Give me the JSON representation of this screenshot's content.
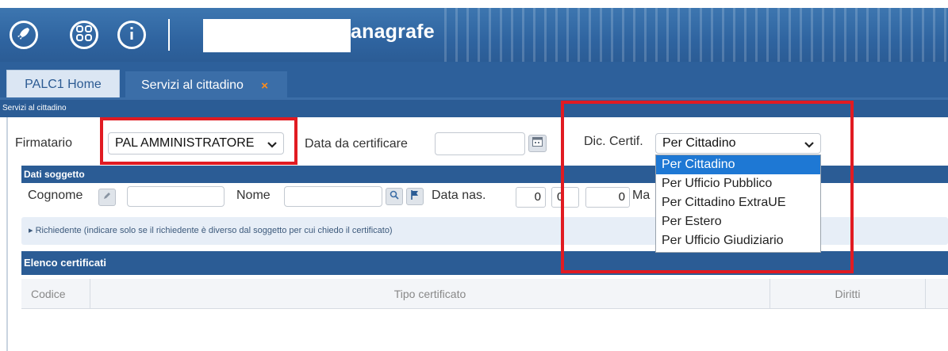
{
  "header": {
    "title": "anagrafe",
    "buttons": [
      {
        "name": "rocket-icon"
      },
      {
        "name": "apps-grid-icon"
      },
      {
        "name": "info-icon"
      }
    ],
    "brand_color": "#2f64a0"
  },
  "tabs": [
    {
      "label": "PALC1 Home",
      "active": false
    },
    {
      "label": "Servizi al cittadino",
      "active": true,
      "close_icon": "×"
    }
  ],
  "breadcrumb": "Servizi al cittadino",
  "form": {
    "firmatario_label": "Firmatario",
    "firmatario_value": "PAL AMMINISTRATORE",
    "data_label": "Data da certificare",
    "data_value": "",
    "dic_label": "Dic. Certif.",
    "dic_value": "Per Cittadino",
    "dic_options": [
      "Per Cittadino",
      "Per Ufficio Pubblico",
      "Per Cittadino ExtraUE",
      "Per Estero",
      "Per Ufficio Giudiziario"
    ]
  },
  "dati_soggetto": {
    "header": "Dati soggetto",
    "cognome_label": "Cognome",
    "cognome_value": "",
    "nome_label": "Nome",
    "nome_value": "",
    "data_nas_label": "Data nas.",
    "day": "0",
    "month": "0",
    "year": "0",
    "trailing_label": "Ma"
  },
  "richiedente": "▸ Richiedente (indicare solo se il richiedente è diverso dal soggetto per cui chiedo il certificato)",
  "elenco": {
    "header": "Elenco certificati",
    "columns": [
      "Codice",
      "Tipo certificato",
      "Diritti"
    ]
  },
  "colors": {
    "highlight": "#e11b22",
    "selection": "#1e78d4",
    "tab_close": "#ff8c1a"
  }
}
